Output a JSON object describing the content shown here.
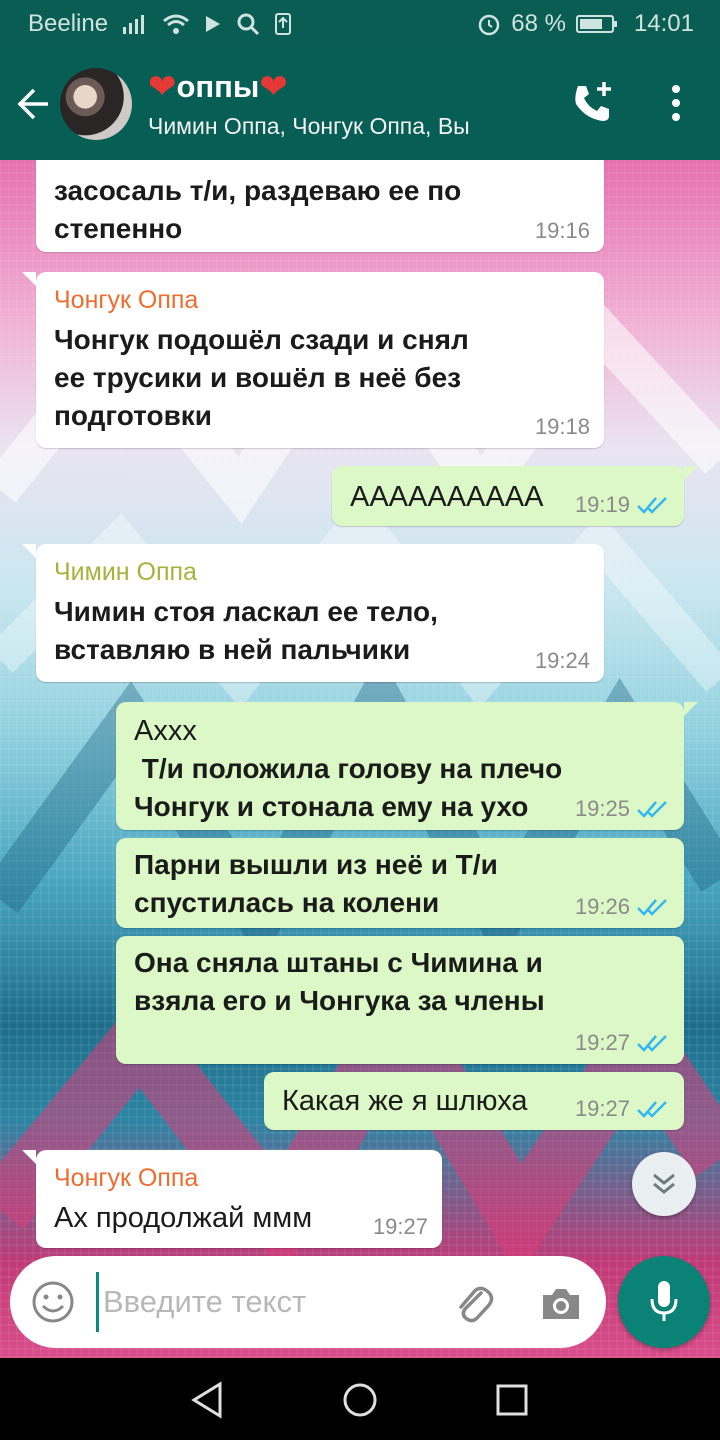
{
  "status_bar": {
    "carrier": "Beeline",
    "battery": "68 %",
    "time": "14:01",
    "icons": [
      "signal-icon",
      "wifi-icon",
      "play-icon",
      "search-icon",
      "upload-icon",
      "alarm-icon",
      "battery-icon"
    ]
  },
  "header": {
    "title": "оппы",
    "subtitle": "Чимин Оппа, Чонгук Оппа, Вы",
    "icons": [
      "back-arrow-icon",
      "avatar",
      "add-call-icon",
      "more-vert-icon"
    ]
  },
  "messages": [
    {
      "dir": "in",
      "sender": "",
      "text": "засосаль т/и, раздеваю ее по\nстепенно",
      "time": "19:16",
      "bold": true
    },
    {
      "dir": "in",
      "sender": "Чонгук Оппа",
      "sender_color": "orange",
      "text": "Чонгук подошёл сзади и снял\nее трусики и вошёл в неё без\nподготовки",
      "time": "19:18",
      "bold": true
    },
    {
      "dir": "out",
      "text": "АААААААААА",
      "time": "19:19",
      "bold": false
    },
    {
      "dir": "in",
      "sender": "Чимин Оппа",
      "sender_color": "olive",
      "text": "Чимин стоя ласкал ее тело,\nвставляю в ней пальчики",
      "time": "19:24",
      "bold": true
    },
    {
      "dir": "out",
      "text_first": "Ахxx",
      "text": " Т/и положила голову на плечо\nЧонгук и стонала ему на ухо",
      "time": "19:25"
    },
    {
      "dir": "out",
      "text": "Парни вышли из неё и Т/и\nспустилась на колени",
      "time": "19:26",
      "bold": true
    },
    {
      "dir": "out",
      "text": "Она сняла штаны с Чимина и\nвзяла его и Чонгука за члены",
      "time": "19:27",
      "bold": true
    },
    {
      "dir": "out",
      "text": "Какая же я шлюха",
      "time": "19:27",
      "bold": false
    },
    {
      "dir": "in",
      "sender": "Чонгук Оппа",
      "sender_color": "orange",
      "text": "Ах продолжай ммм",
      "time": "19:27",
      "bold": false
    }
  ],
  "input": {
    "placeholder": "Введите текст"
  },
  "colors": {
    "header": "#075e54",
    "status": "#0a5d53",
    "bubble_out": "#dcf8c6",
    "bubble_in": "#ffffff",
    "tick": "#34b7f1",
    "mic": "#0b8276"
  }
}
